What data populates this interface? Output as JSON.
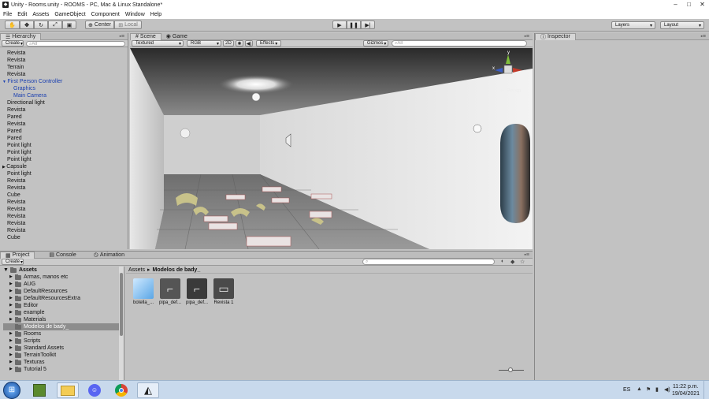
{
  "window": {
    "title": "Unity - Rooms.unity - ROOMS - PC, Mac & Linux Standalone*",
    "minimize": "–",
    "maximize": "□",
    "close": "✕"
  },
  "menu": [
    "File",
    "Edit",
    "Assets",
    "GameObject",
    "Component",
    "Window",
    "Help"
  ],
  "toolbar": {
    "pivot_label": "Center",
    "space_label": "Local",
    "layers_label": "Layers",
    "layout_label": "Layout"
  },
  "hierarchy": {
    "tab": "Hierarchy",
    "create": "Create",
    "search_placeholder": "All",
    "items": [
      {
        "label": "Revista"
      },
      {
        "label": "Revista"
      },
      {
        "label": "Terrain"
      },
      {
        "label": "Revista"
      },
      {
        "label": "First Person Controller",
        "blue": true,
        "expanded": true
      },
      {
        "label": "Graphics",
        "blue": true,
        "indent": true
      },
      {
        "label": "Main Camera",
        "blue": true,
        "indent": true
      },
      {
        "label": "Directional light"
      },
      {
        "label": "Revista"
      },
      {
        "label": "Pared"
      },
      {
        "label": "Revista"
      },
      {
        "label": "Pared"
      },
      {
        "label": "Pared"
      },
      {
        "label": "Point light"
      },
      {
        "label": "Point light"
      },
      {
        "label": "Point light"
      },
      {
        "label": "Capsule",
        "collapsed": true
      },
      {
        "label": "Point light"
      },
      {
        "label": "Revista"
      },
      {
        "label": "Revista"
      },
      {
        "label": "Cube"
      },
      {
        "label": "Revista"
      },
      {
        "label": "Revista"
      },
      {
        "label": "Revista"
      },
      {
        "label": "Revista"
      },
      {
        "label": "Revista"
      },
      {
        "label": "Cube"
      }
    ]
  },
  "scene": {
    "tab_scene": "Scene",
    "tab_game": "Game",
    "shading": "Textured",
    "render_mode": "RGB",
    "mode_2d": "2D",
    "effects": "Effects",
    "gizmos": "Gizmos",
    "search_placeholder": "All",
    "persp": "Persp",
    "axis_y": "y",
    "axis_x": "x"
  },
  "inspector": {
    "tab": "Inspector"
  },
  "bottom": {
    "tab_project": "Project",
    "tab_console": "Console",
    "tab_animation": "Animation",
    "create": "Create",
    "breadcrumb_root": "Assets",
    "breadcrumb_sep": "▸",
    "breadcrumb_current": "Modelos de bady_",
    "tree_root": "Assets",
    "folders": [
      {
        "label": "Armas, manos etc"
      },
      {
        "label": "AUG"
      },
      {
        "label": "DefaultResources"
      },
      {
        "label": "DefaultResourcesExtra"
      },
      {
        "label": "Editor"
      },
      {
        "label": "example"
      },
      {
        "label": "Materials"
      },
      {
        "label": "Modelos de bady_",
        "selected": true
      },
      {
        "label": "Rooms"
      },
      {
        "label": "Scripts"
      },
      {
        "label": "Standard Assets"
      },
      {
        "label": "TerrainToolkit"
      },
      {
        "label": "Texturas"
      },
      {
        "label": "Tutorial 5"
      }
    ],
    "assets": [
      {
        "label": "botella_...",
        "kind": "bottle"
      },
      {
        "label": "pipa_def...",
        "kind": "gun"
      },
      {
        "label": "pipa_def...",
        "kind": "gun-dark"
      },
      {
        "label": "Revista 1",
        "kind": "magazine"
      }
    ]
  },
  "taskbar": {
    "lang": "ES",
    "time": "11:22 p.m.",
    "date": "19/04/2021"
  },
  "colors": {
    "hier_blue": "#1a3fb0",
    "selection": "#8d8d8d",
    "taskbar": "#c8d9ec"
  }
}
